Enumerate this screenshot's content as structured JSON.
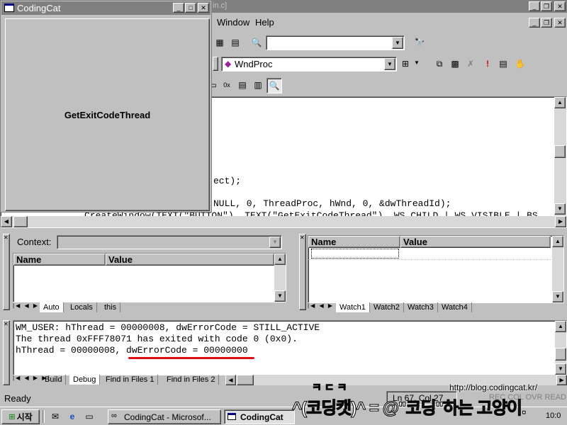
{
  "ide": {
    "title_fragment": "in.c]",
    "menu": [
      "Window",
      "Help"
    ],
    "function_combo": "WndProc",
    "code_lines": [
      "ect);",
      "NULL, 0, ThreadProc, hWnd, 0, &dwThreadId);",
      "CreateWindow(TEXT(\"BUTTON\"), TEXT(\"GetExitCodeThread\"), WS_CHILD | WS_VISIBLE | BS_"
    ]
  },
  "app_window": {
    "title": "CodingCat",
    "button_label": "GetExitCodeThread"
  },
  "variables": {
    "context_label": "Context:",
    "columns": [
      "Name",
      "Value"
    ],
    "tabs": [
      "Auto",
      "Locals",
      "this"
    ]
  },
  "watch": {
    "columns": [
      "Name",
      "Value"
    ],
    "tabs": [
      "Watch1",
      "Watch2",
      "Watch3",
      "Watch4"
    ]
  },
  "output": {
    "lines": [
      "WM_USER: hThread = 00000008, dwErrorCode = STILL_ACTIVE",
      "The thread 0xFFF78071 has exited with code 0 (0x0).",
      "hThread = 00000008, ",
      "dwErrorCode = 00000000"
    ],
    "tabs": [
      "Build",
      "Debug",
      "Find in Files 1",
      "Find in Files 2"
    ],
    "highlight_color": "#e01010"
  },
  "status": {
    "text": "Ready",
    "position": "Ln 67, Col 27",
    "indicators": "REC COL OVR READ"
  },
  "taskbar": {
    "start": "시작",
    "tasks": [
      "CodingCat - Microsof...",
      "CodingCat"
    ],
    "clock": "10:0"
  },
  "watermark": {
    "url": "http://blog.codingcat.kr/",
    "small": "ㅋㄷㅋ",
    "slogan": "^(코딩캣)^ = @\"코딩\"하는 고양이."
  }
}
